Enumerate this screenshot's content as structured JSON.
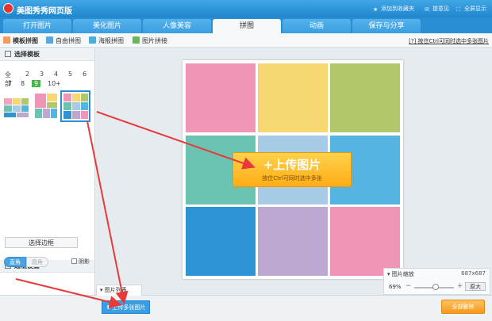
{
  "app": {
    "title": "美图秀秀网页版"
  },
  "title_links": {
    "bookmark": "添加到收藏夹",
    "feedback": "提意见",
    "fullscreen": "全屏显示"
  },
  "tabs": [
    {
      "label": "打开图片"
    },
    {
      "label": "美化图片"
    },
    {
      "label": "人像美容"
    },
    {
      "label": "拼图"
    },
    {
      "label": "动画"
    },
    {
      "label": "保存与分享"
    }
  ],
  "subtabs": [
    {
      "label": "模板拼图"
    },
    {
      "label": "自由拼图"
    },
    {
      "label": "海报拼图"
    },
    {
      "label": "图片拼接"
    }
  ],
  "sub_hint": "[?] 按住Ctrl可同时选中多张图片",
  "template_panel": {
    "title": "选择模板",
    "counts_row1": [
      "全部",
      "2",
      "3",
      "4",
      "5",
      "6"
    ],
    "counts_row2": [
      "7",
      "8",
      "9",
      "10+"
    ],
    "selected_count": "9"
  },
  "edge_panel": {
    "title": "边框设置",
    "choose_edge": "选择边框",
    "seg_straight": "直角",
    "seg_round": "圆角",
    "shadow": "阴影"
  },
  "canvas": {
    "cell_colors": [
      "#ef95b8",
      "#f7d772",
      "#b2c66c",
      "#6dc3b2",
      "#a8cbe6",
      "#55b4e0",
      "#2d95d3",
      "#bda8d2",
      "#ef95b8"
    ],
    "upload_main": "+上传图片",
    "upload_sub": "按住Ctrl可同时选中多张"
  },
  "zoom": {
    "title": "图片缩放",
    "size": "687x687",
    "percent": "69%",
    "percent_value": 0.69,
    "button": "原大"
  },
  "bottom": {
    "image_list_tab": "图片列表",
    "upload_multi": "上传多张图片",
    "delete_all": "全部删除"
  }
}
